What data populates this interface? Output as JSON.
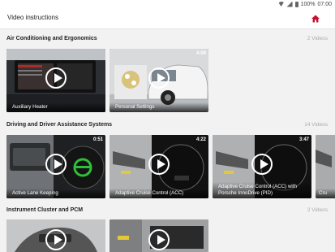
{
  "status_bar": {
    "battery": "100%",
    "time": "07:00"
  },
  "app_bar": {
    "title": "Video instructions",
    "home_icon": "home-icon",
    "accent": "#c8102e"
  },
  "sections": [
    {
      "title": "Air Conditioning and Ergonomics",
      "count": "2 Videos",
      "videos": [
        {
          "title": "Auxiliary Heater",
          "duration": ""
        },
        {
          "title": "Personal Settings",
          "duration": "4:09"
        }
      ]
    },
    {
      "title": "Driving and Driver Assistance Systems",
      "count": "14 Videos",
      "videos": [
        {
          "title": "Active Lane Keeping",
          "duration": "0:51"
        },
        {
          "title": "Adaptive Cruise Control (ACC)",
          "duration": "4:22"
        },
        {
          "title": "Adaptive Cruise Control (ACC) with Porsche InnoDrive (PID)",
          "duration": "3:47"
        },
        {
          "title": "Cru",
          "duration": ""
        }
      ]
    },
    {
      "title": "Instrument Cluster and PCM",
      "count": "2 Videos",
      "videos": [
        {
          "title": "",
          "duration": ""
        },
        {
          "title": "",
          "duration": ""
        }
      ]
    }
  ]
}
